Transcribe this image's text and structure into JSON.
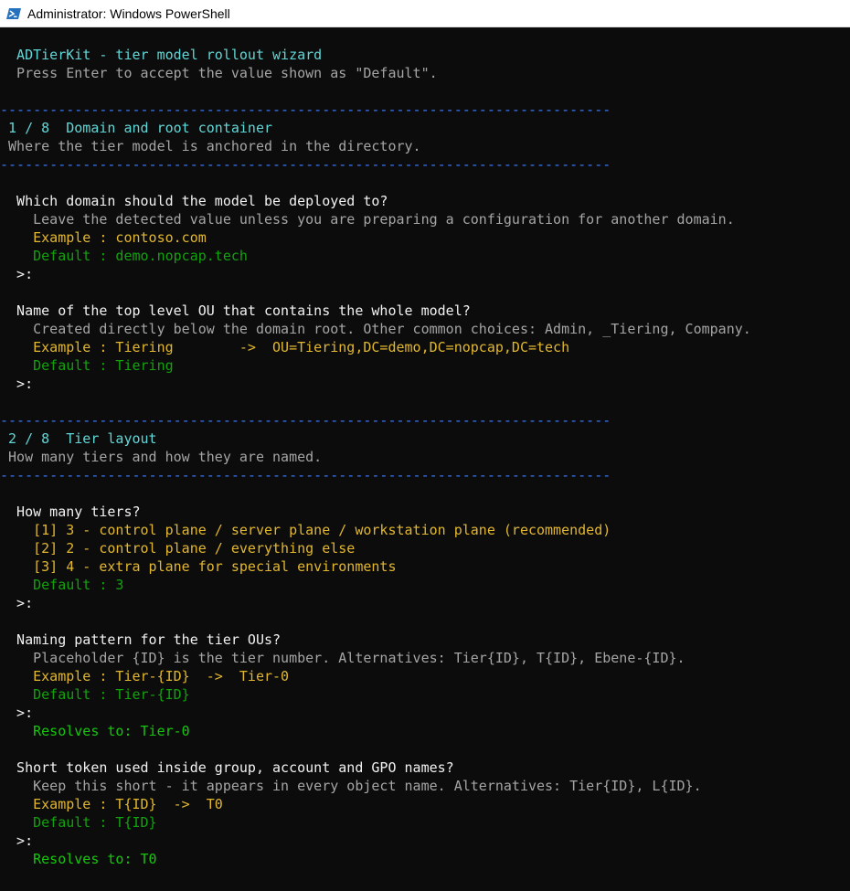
{
  "window": {
    "title": "Administrator: Windows PowerShell"
  },
  "colors": {
    "cyan": "#61d6d6",
    "dim": "#a5a5a5",
    "white": "#f2f2f2",
    "yellow": "#e2b72f",
    "green": "#13a10e",
    "bright_green": "#16c60c",
    "separator": "#3b78ff",
    "background": "#0c0c0c"
  },
  "icons": {
    "app": "powershell-icon"
  },
  "console": {
    "header_title": "  ADTierKit - tier model rollout wizard",
    "header_hint": "  Press Enter to accept the value shown as \"Default\".",
    "separator": "--------------------------------------------------------------------------",
    "step1": {
      "title": " 1 / 8  Domain and root container",
      "subtitle": " Where the tier model is anchored in the directory."
    },
    "q_domain": {
      "question": "  Which domain should the model be deployed to?",
      "hint": "    Leave the detected value unless you are preparing a configuration for another domain.",
      "example": "    Example : contoso.com",
      "default": "    Default : demo.nopcap.tech",
      "prompt": "  >:"
    },
    "q_ou": {
      "question": "  Name of the top level OU that contains the whole model?",
      "hint": "    Created directly below the domain root. Other common choices: Admin, _Tiering, Company.",
      "example": "    Example : Tiering        ->  OU=Tiering,DC=demo,DC=nopcap,DC=tech",
      "default": "    Default : Tiering",
      "prompt": "  >:"
    },
    "step2": {
      "title": " 2 / 8  Tier layout",
      "subtitle": " How many tiers and how they are named."
    },
    "q_tiers": {
      "question": "  How many tiers?",
      "options": [
        "    [1] 3 - control plane / server plane / workstation plane (recommended)",
        "    [2] 2 - control plane / everything else",
        "    [3] 4 - extra plane for special environments"
      ],
      "default": "    Default : 3",
      "prompt": "  >:"
    },
    "q_pattern": {
      "question": "  Naming pattern for the tier OUs?",
      "hint": "    Placeholder {ID} is the tier number. Alternatives: Tier{ID}, T{ID}, Ebene-{ID}.",
      "example": "    Example : Tier-{ID}  ->  Tier-0",
      "default": "    Default : Tier-{ID}",
      "prompt": "  >:",
      "resolves": "    Resolves to: Tier-0"
    },
    "q_token": {
      "question": "  Short token used inside group, account and GPO names?",
      "hint": "    Keep this short - it appears in every object name. Alternatives: Tier{ID}, L{ID}.",
      "example": "    Example : T{ID}  ->  T0",
      "default": "    Default : T{ID}",
      "prompt": "  >:",
      "resolves": "    Resolves to: T0"
    }
  }
}
